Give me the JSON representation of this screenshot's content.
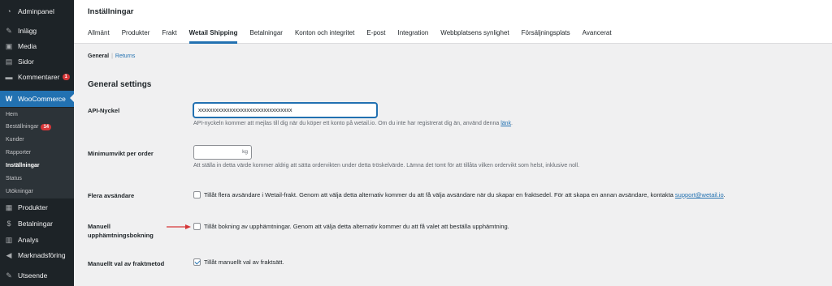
{
  "sidebar": {
    "items": [
      {
        "label": "Adminpanel",
        "icon": "dashboard-icon",
        "glyph": "◔"
      },
      {
        "label": "Inlägg",
        "icon": "pin-icon",
        "glyph": "✎"
      },
      {
        "label": "Media",
        "icon": "media-icon",
        "glyph": "▣"
      },
      {
        "label": "Sidor",
        "icon": "pages-icon",
        "glyph": "▤"
      },
      {
        "label": "Kommentarer",
        "icon": "comments-icon",
        "glyph": "▬",
        "badge": "1"
      },
      {
        "label": "WooCommerce",
        "icon": "woocommerce-icon",
        "glyph": "W"
      },
      {
        "label": "Produkter",
        "icon": "products-icon",
        "glyph": "▦"
      },
      {
        "label": "Betalningar",
        "icon": "payments-icon",
        "glyph": "$"
      },
      {
        "label": "Analys",
        "icon": "analytics-icon",
        "glyph": "▥"
      },
      {
        "label": "Marknadsföring",
        "icon": "marketing-icon",
        "glyph": "◀"
      },
      {
        "label": "Utseende",
        "icon": "appearance-icon",
        "glyph": "✎"
      }
    ],
    "submenu": [
      {
        "label": "Hem"
      },
      {
        "label": "Beställningar",
        "badge": "14"
      },
      {
        "label": "Kunder"
      },
      {
        "label": "Rapporter"
      },
      {
        "label": "Inställningar",
        "current": true
      },
      {
        "label": "Status"
      },
      {
        "label": "Utökningar"
      }
    ]
  },
  "header": {
    "title": "Inställningar",
    "tabs": [
      "Allmänt",
      "Produkter",
      "Frakt",
      "Wetail Shipping",
      "Betalningar",
      "Konton och integritet",
      "E-post",
      "Integration",
      "Webbplatsens synlighet",
      "Försäljningsplats",
      "Avancerat"
    ],
    "active_tab": "Wetail Shipping"
  },
  "subnav": {
    "current": "General",
    "separator": "|",
    "other": "Returns"
  },
  "section_title": "General settings",
  "fields": {
    "api": {
      "label": "API-Nyckel",
      "value": "xxxxxxxxxxxxxxxxxxxxxxxxxxxxxxxxx",
      "desc": "API-nyckeln kommer att mejlas till dig när du köper ett konto på wetail.io. Om du inte har registrerat dig än, använd denna",
      "desc_link": "länk",
      "desc_end": "."
    },
    "min_weight": {
      "label": "Minimumvikt per order",
      "unit": "kg",
      "desc": "Att ställa in detta värde kommer aldrig att sätta ordervikten under detta tröskelvärde. Lämna det tomt för att tillåta vilken ordervikt som helst, inklusive noll."
    },
    "senders": {
      "label": "Flera avsändare",
      "checked": false,
      "text": "Tillåt flera avsändare i Wetail-frakt. Genom att välja detta alternativ kommer du att få välja avsändare när du skapar en fraktsedel. För att skapa en annan avsändare, kontakta",
      "link": "support@wetail.io",
      "end": "."
    },
    "pickup": {
      "label_line1": "Manuell",
      "label_line2": "upphämtningsbokning",
      "checked": false,
      "text": "Tillåt bokning av upphämtningar. Genom att välja detta alternativ kommer du att få valet att beställa upphämtning."
    },
    "shipping_method": {
      "label": "Manuellt val av fraktmetod",
      "checked": true,
      "text": "Tillåt manuellt val av fraktsätt."
    }
  },
  "colors": {
    "accent": "#2271b1",
    "sidebar": "#1d2327",
    "arrow": "#d63638"
  }
}
